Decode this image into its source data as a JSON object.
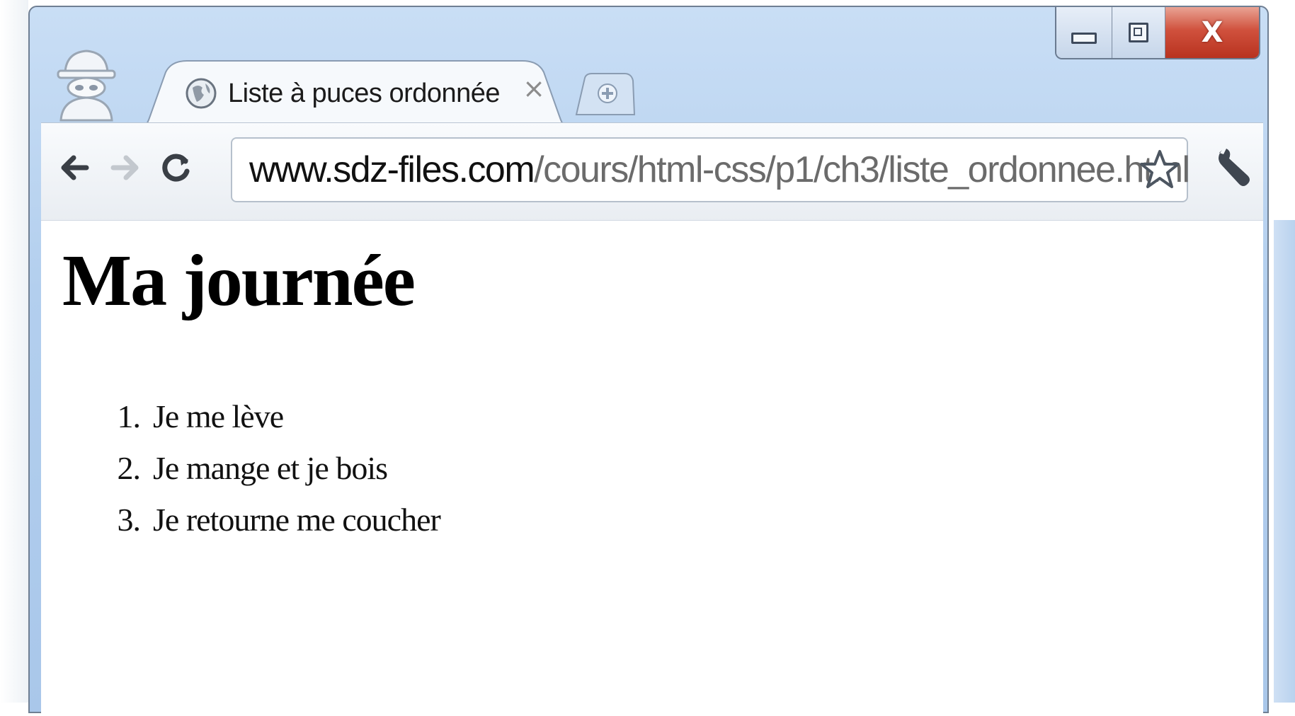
{
  "browser": {
    "tab": {
      "title": "Liste à puces ordonnée",
      "close_glyph": "×",
      "icon": "globe-icon"
    },
    "new_tab_icon": "new-tab-icon",
    "window_controls": {
      "close_glyph": "X",
      "minimize_icon": "minimize-icon",
      "maximize_icon": "maximize-icon"
    },
    "address": {
      "host": "www.sdz-files.com",
      "path": "/cours/html-css/p1/ch3/liste_ordonnee.html"
    },
    "toolbar_icons": [
      "back-arrow-icon",
      "forward-arrow-icon",
      "reload-icon",
      "star-icon",
      "wrench-icon"
    ]
  },
  "page": {
    "heading": "Ma journée",
    "list": [
      {
        "number": "1.",
        "text": "Je me lève"
      },
      {
        "number": "2.",
        "text": "Je mange et je bois"
      },
      {
        "number": "3.",
        "text": "Je retourne me coucher"
      }
    ]
  },
  "colors": {
    "frame": "#b3cfee",
    "close_button": "#c8432f",
    "url_host": "#111111",
    "url_path": "#6b6b6b"
  }
}
